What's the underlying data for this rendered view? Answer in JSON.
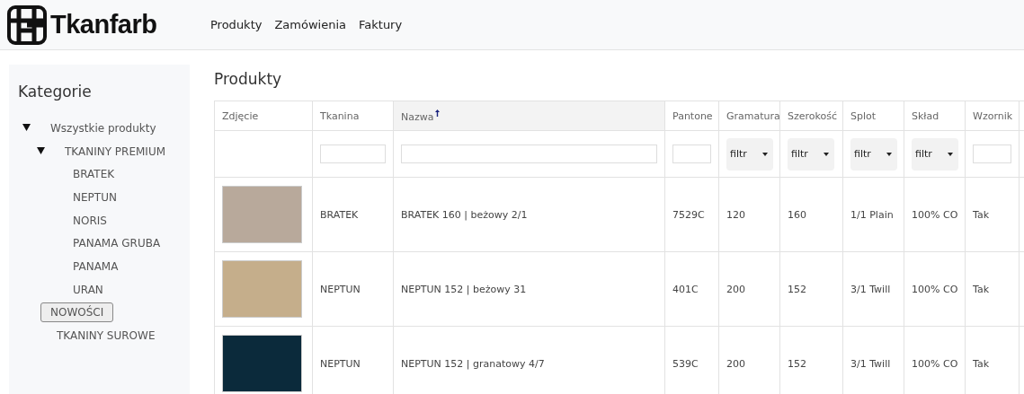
{
  "brand": {
    "name": "Tkanfarb"
  },
  "nav": [
    {
      "label": "Produkty"
    },
    {
      "label": "Zamówienia"
    },
    {
      "label": "Faktury"
    }
  ],
  "sidebar": {
    "title": "Kategorie",
    "items": [
      {
        "label": "Wszystkie produkty",
        "expanded": true,
        "selected": false,
        "children": [
          {
            "label": "TKANINY PREMIUM",
            "expanded": true,
            "selected": false,
            "children": [
              {
                "label": "BRATEK",
                "selected": false
              },
              {
                "label": "NEPTUN",
                "selected": false
              },
              {
                "label": "NORIS",
                "selected": false
              },
              {
                "label": "PANAMA GRUBA",
                "selected": false
              },
              {
                "label": "PANAMA",
                "selected": false
              },
              {
                "label": "URAN",
                "selected": false
              }
            ]
          },
          {
            "label": "NOWOŚCI",
            "selected": true
          },
          {
            "label": "TKANINY SUROWE",
            "selected": false
          }
        ]
      }
    ]
  },
  "page_title": "Produkty",
  "table": {
    "columns": [
      {
        "label": "Zdjęcie",
        "sorted": false,
        "filter": {
          "kind": "none"
        }
      },
      {
        "label": "Tkanina",
        "sorted": false,
        "filter": {
          "kind": "text"
        }
      },
      {
        "label": "Nazwa",
        "sorted": true,
        "filter": {
          "kind": "text"
        }
      },
      {
        "label": "Pantone",
        "sorted": false,
        "filter": {
          "kind": "text"
        }
      },
      {
        "label": "Gramatura",
        "sorted": false,
        "filter": {
          "kind": "select",
          "label": "filtr"
        }
      },
      {
        "label": "Szerokość",
        "sorted": false,
        "filter": {
          "kind": "select",
          "label": "filtr"
        }
      },
      {
        "label": "Splot",
        "sorted": false,
        "filter": {
          "kind": "select",
          "label": "filtr"
        }
      },
      {
        "label": "Skład",
        "sorted": false,
        "filter": {
          "kind": "select",
          "label": "filtr"
        }
      },
      {
        "label": "Wzornik",
        "sorted": false,
        "filter": {
          "kind": "text"
        }
      }
    ],
    "rows": [
      {
        "color": "#b8a99b",
        "cells": [
          "",
          "BRATEK",
          "BRATEK 160 | beżowy 2/1",
          "7529C",
          "120",
          "160",
          "1/1 Plain",
          "100% CO",
          "Tak"
        ]
      },
      {
        "color": "#c5ae8b",
        "cells": [
          "",
          "NEPTUN",
          "NEPTUN 152 | beżowy 31",
          "401C",
          "200",
          "152",
          "3/1 Twill",
          "100% CO",
          "Tak"
        ]
      },
      {
        "color": "#0b2a3b",
        "cells": [
          "",
          "NEPTUN",
          "NEPTUN 152 | granatowy 4/7",
          "539C",
          "200",
          "152",
          "3/1 Twill",
          "100% CO",
          "Tak"
        ]
      }
    ]
  }
}
